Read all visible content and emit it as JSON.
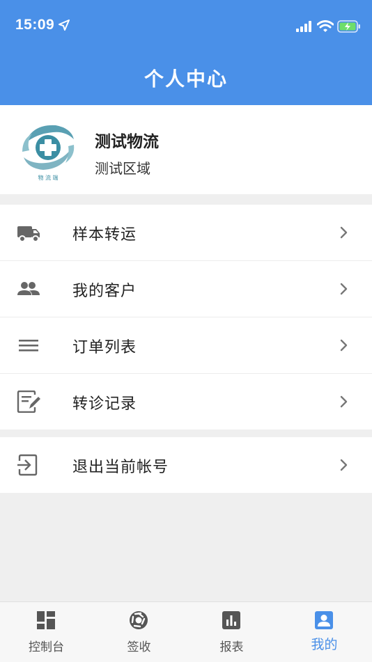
{
  "status_bar": {
    "time": "15:09"
  },
  "header": {
    "title": "个人中心"
  },
  "profile": {
    "name": "测试物流",
    "area": "测试区域",
    "logo_text": "物 流 端"
  },
  "menu": [
    {
      "label": "样本转运",
      "icon": "truck-icon"
    },
    {
      "label": "我的客户",
      "icon": "people-icon"
    },
    {
      "label": "订单列表",
      "icon": "list-icon"
    },
    {
      "label": "转诊记录",
      "icon": "edit-note-icon"
    }
  ],
  "logout": {
    "label": "退出当前帐号",
    "icon": "exit-icon"
  },
  "tabs": [
    {
      "label": "控制台",
      "icon": "dashboard-icon"
    },
    {
      "label": "签收",
      "icon": "aperture-icon"
    },
    {
      "label": "报表",
      "icon": "bar-chart-icon"
    },
    {
      "label": "我的",
      "icon": "person-icon",
      "active": true
    }
  ],
  "colors": {
    "primary": "#4a90e8",
    "icon_gray": "#666666",
    "background": "#efefef"
  }
}
